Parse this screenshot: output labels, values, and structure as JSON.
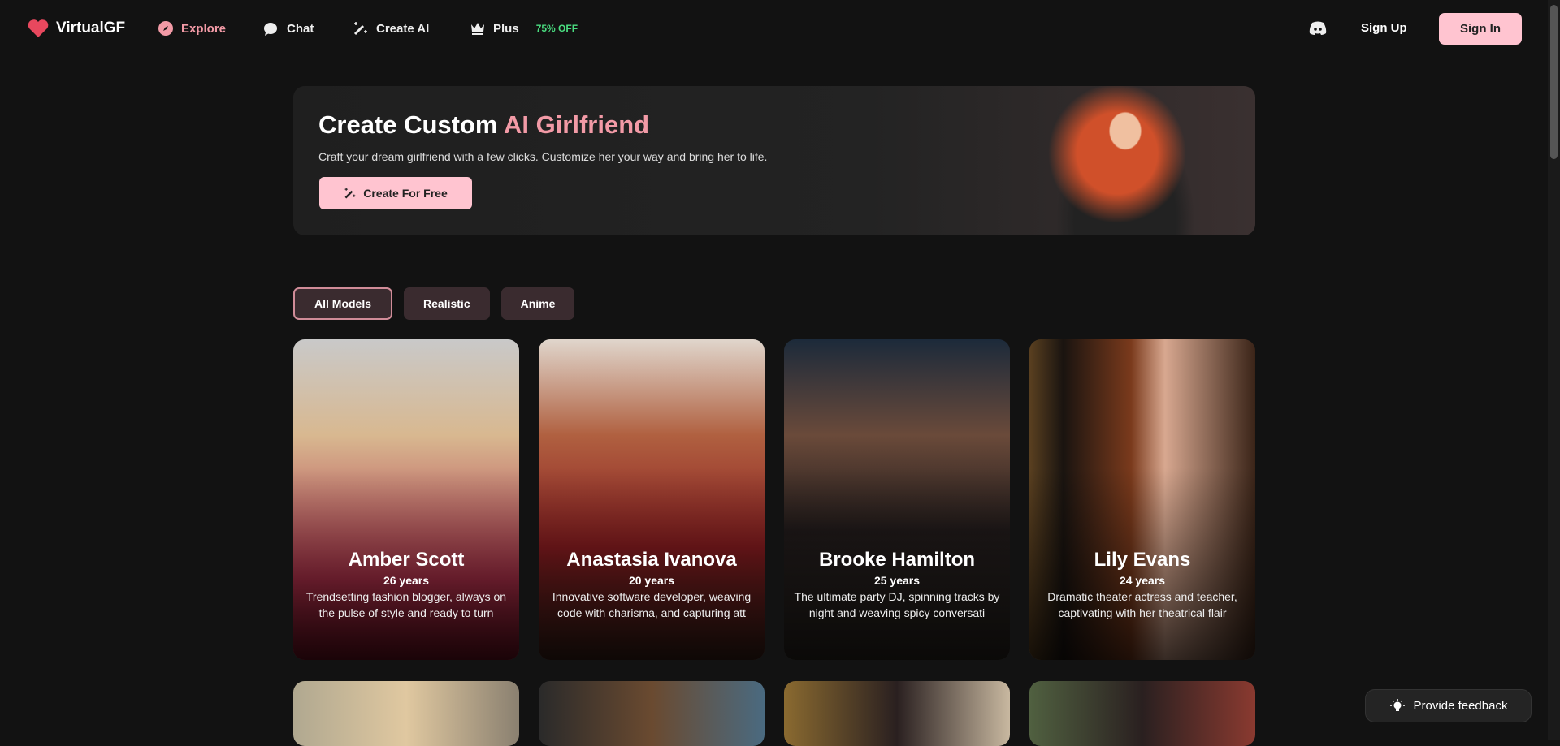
{
  "nav": {
    "brand": "VirtualGF",
    "items": [
      {
        "label": "Explore",
        "icon": "compass-icon"
      },
      {
        "label": "Chat",
        "icon": "chat-bubbles-icon"
      },
      {
        "label": "Create AI",
        "icon": "magic-wand-icon"
      },
      {
        "label": "Plus",
        "icon": "crown-icon"
      }
    ],
    "plus_badge": "75% OFF",
    "sign_up": "Sign Up",
    "sign_in": "Sign In"
  },
  "banner": {
    "title_prefix": "Create Custom ",
    "title_highlight": "AI Girlfriend",
    "subtitle": "Craft your dream girlfriend with a few clicks. Customize her your way and bring her to life.",
    "button": "Create For Free"
  },
  "filters": [
    "All Models",
    "Realistic",
    "Anime"
  ],
  "cards": [
    {
      "name": "Amber Scott",
      "age": "26 years",
      "desc": "Trendsetting fashion blogger, always on the pulse of style and ready to turn"
    },
    {
      "name": "Anastasia Ivanova",
      "age": "20 years",
      "desc": "Innovative software developer, weaving code with charisma, and capturing att"
    },
    {
      "name": "Brooke Hamilton",
      "age": "25 years",
      "desc": "The ultimate party DJ, spinning tracks by night and weaving spicy conversati"
    },
    {
      "name": "Lily Evans",
      "age": "24 years",
      "desc": "Dramatic theater actress and teacher, captivating with her theatrical flair"
    }
  ],
  "feedback": "Provide feedback",
  "colors": {
    "accent": "#f29aa6",
    "button": "#ffc4d0",
    "badge": "#4ade80"
  }
}
